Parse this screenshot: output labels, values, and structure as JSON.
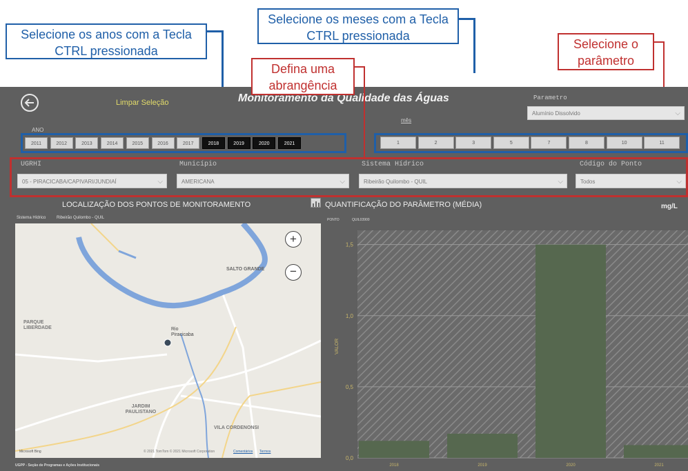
{
  "annotations": {
    "years_hint": "Selecione os anos com a Tecla CTRL pressionada",
    "months_hint": "Selecione os meses com a Tecla CTRL pressionada",
    "scope_hint": "Defina uma abrangência",
    "param_hint": "Selecione o parâmetro"
  },
  "header": {
    "title": "Monitoramento da Qualidade das Águas",
    "clear_label": "Limpar Seleção",
    "back_icon": "back-arrow-icon"
  },
  "year_filter": {
    "label": "ANO",
    "years": [
      {
        "label": "2011",
        "selected": false
      },
      {
        "label": "2012",
        "selected": false
      },
      {
        "label": "2013",
        "selected": false
      },
      {
        "label": "2014",
        "selected": false
      },
      {
        "label": "2015",
        "selected": false
      },
      {
        "label": "2016",
        "selected": false
      },
      {
        "label": "2017",
        "selected": false
      },
      {
        "label": "2018",
        "selected": true
      },
      {
        "label": "2019",
        "selected": true
      },
      {
        "label": "2020",
        "selected": true
      },
      {
        "label": "2021",
        "selected": true
      }
    ]
  },
  "month_filter": {
    "label": "mês",
    "months": [
      "1",
      "2",
      "3",
      "5",
      "7",
      "8",
      "10",
      "11"
    ]
  },
  "parameter": {
    "label": "Parametro",
    "value": "Alumínio Dissolvido"
  },
  "filters": {
    "ugrhi": {
      "label": "UGRHI",
      "value": "05 - PIRACICABA/CAPIVARI/JUNDIAÍ"
    },
    "municipio": {
      "label": "Município",
      "value": "AMERICANA"
    },
    "sistema": {
      "label": "Sistema Hídrico",
      "value": "Ribeirão Quilombo - QUIL"
    },
    "codigo": {
      "label": "Código do Ponto",
      "value": "Todos"
    }
  },
  "map_panel": {
    "title": "LOCALIZAÇÃO DOS PONTOS DE MONITORAMENTO",
    "subtitle_label": "Sistema Hídrico",
    "subtitle_value": "Ribeirão Quilombo - QUIL",
    "places": {
      "salto": "SALTO GRANDE",
      "parque": "PARQUE LIBERDADE",
      "rio": "Rio Piracicaba",
      "jardim": "JARDIM PAULISTANO",
      "vila": "VILA CORDENONSI"
    },
    "zoom_in": "+",
    "zoom_out": "−",
    "footer_logo": "Microsoft Bing",
    "footer_copyright": "© 2021 TomTom © 2021 Microsoft Corporation",
    "footer_terms_link": "Comentários",
    "footer_terms": "Termos"
  },
  "chart_panel": {
    "title": "QUANTIFICAÇÃO DO PARÂMETRO (MÉDIA)",
    "unit": "mg/L",
    "point_label": "PONTO",
    "point_value": "QUIL03900"
  },
  "footer": {
    "text": "UGPP - Seção de Programas e Ações Institucionais"
  },
  "chart_data": {
    "type": "bar",
    "categories": [
      "2018",
      "2019",
      "2020",
      "2021"
    ],
    "values": [
      0.12,
      0.17,
      1.5,
      0.09
    ],
    "ylabel": "VALOR",
    "ylim": [
      0,
      1.6
    ],
    "yticks": [
      "0,0",
      "0,5",
      "1,0",
      "1,5"
    ],
    "bar_color": "#56684f",
    "grid": true
  }
}
